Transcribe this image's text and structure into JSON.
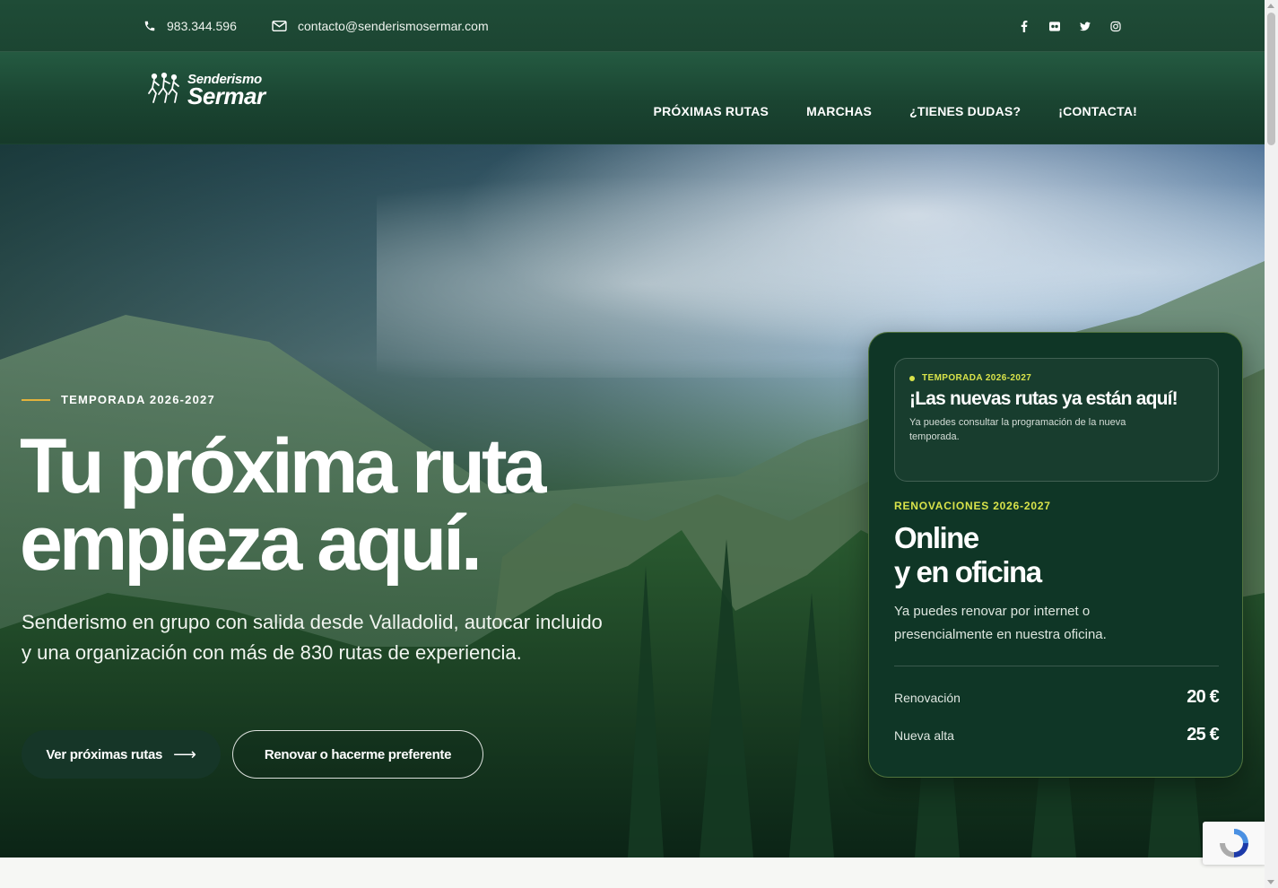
{
  "topbar": {
    "phone": "983.344.596",
    "email": "contacto@senderismosermar.com",
    "social": [
      "facebook-icon",
      "flickr-icon",
      "twitter-icon",
      "instagram-icon"
    ]
  },
  "header": {
    "logo_small": "Senderismo",
    "logo_big": "Sermar",
    "nav": [
      {
        "label": "PRÓXIMAS RUTAS"
      },
      {
        "label": "MARCHAS"
      },
      {
        "label": "¿TIENES DUDAS?"
      },
      {
        "label": "¡CONTACTA!"
      }
    ]
  },
  "hero": {
    "eyebrow": "TEMPORADA 2026-2027",
    "headline_line1": "Tu próxima ruta",
    "headline_line2": "empieza aquí.",
    "lead": "Senderismo en grupo con salida desde Valladolid, autocar incluido y una organización con más de 830 rutas de experiencia.",
    "primary_button": "Ver próximas rutas",
    "primary_arrow": "⟶",
    "secondary_button": "Renovar o hacerme preferente"
  },
  "card": {
    "notice_tag": "TEMPORADA 2026-2027",
    "notice_title": "¡Las nuevas rutas ya están aquí!",
    "notice_desc": "Ya puedes consultar la programación de la nueva temporada.",
    "kicker": "RENOVACIONES 2026-2027",
    "big_line1": "Online",
    "big_line2": "y en oficina",
    "text": "Ya puedes renovar por internet o presencialmente en nuestra oficina.",
    "prices": [
      {
        "label": "Renovación",
        "value": "20 €"
      },
      {
        "label": "Nueva alta",
        "value": "25 €"
      }
    ]
  },
  "colors": {
    "brand_green": "#1c4532",
    "card_bg": "#0f3626",
    "accent_yellow": "#d9e34a",
    "eyebrow_line": "#e3b23c"
  }
}
